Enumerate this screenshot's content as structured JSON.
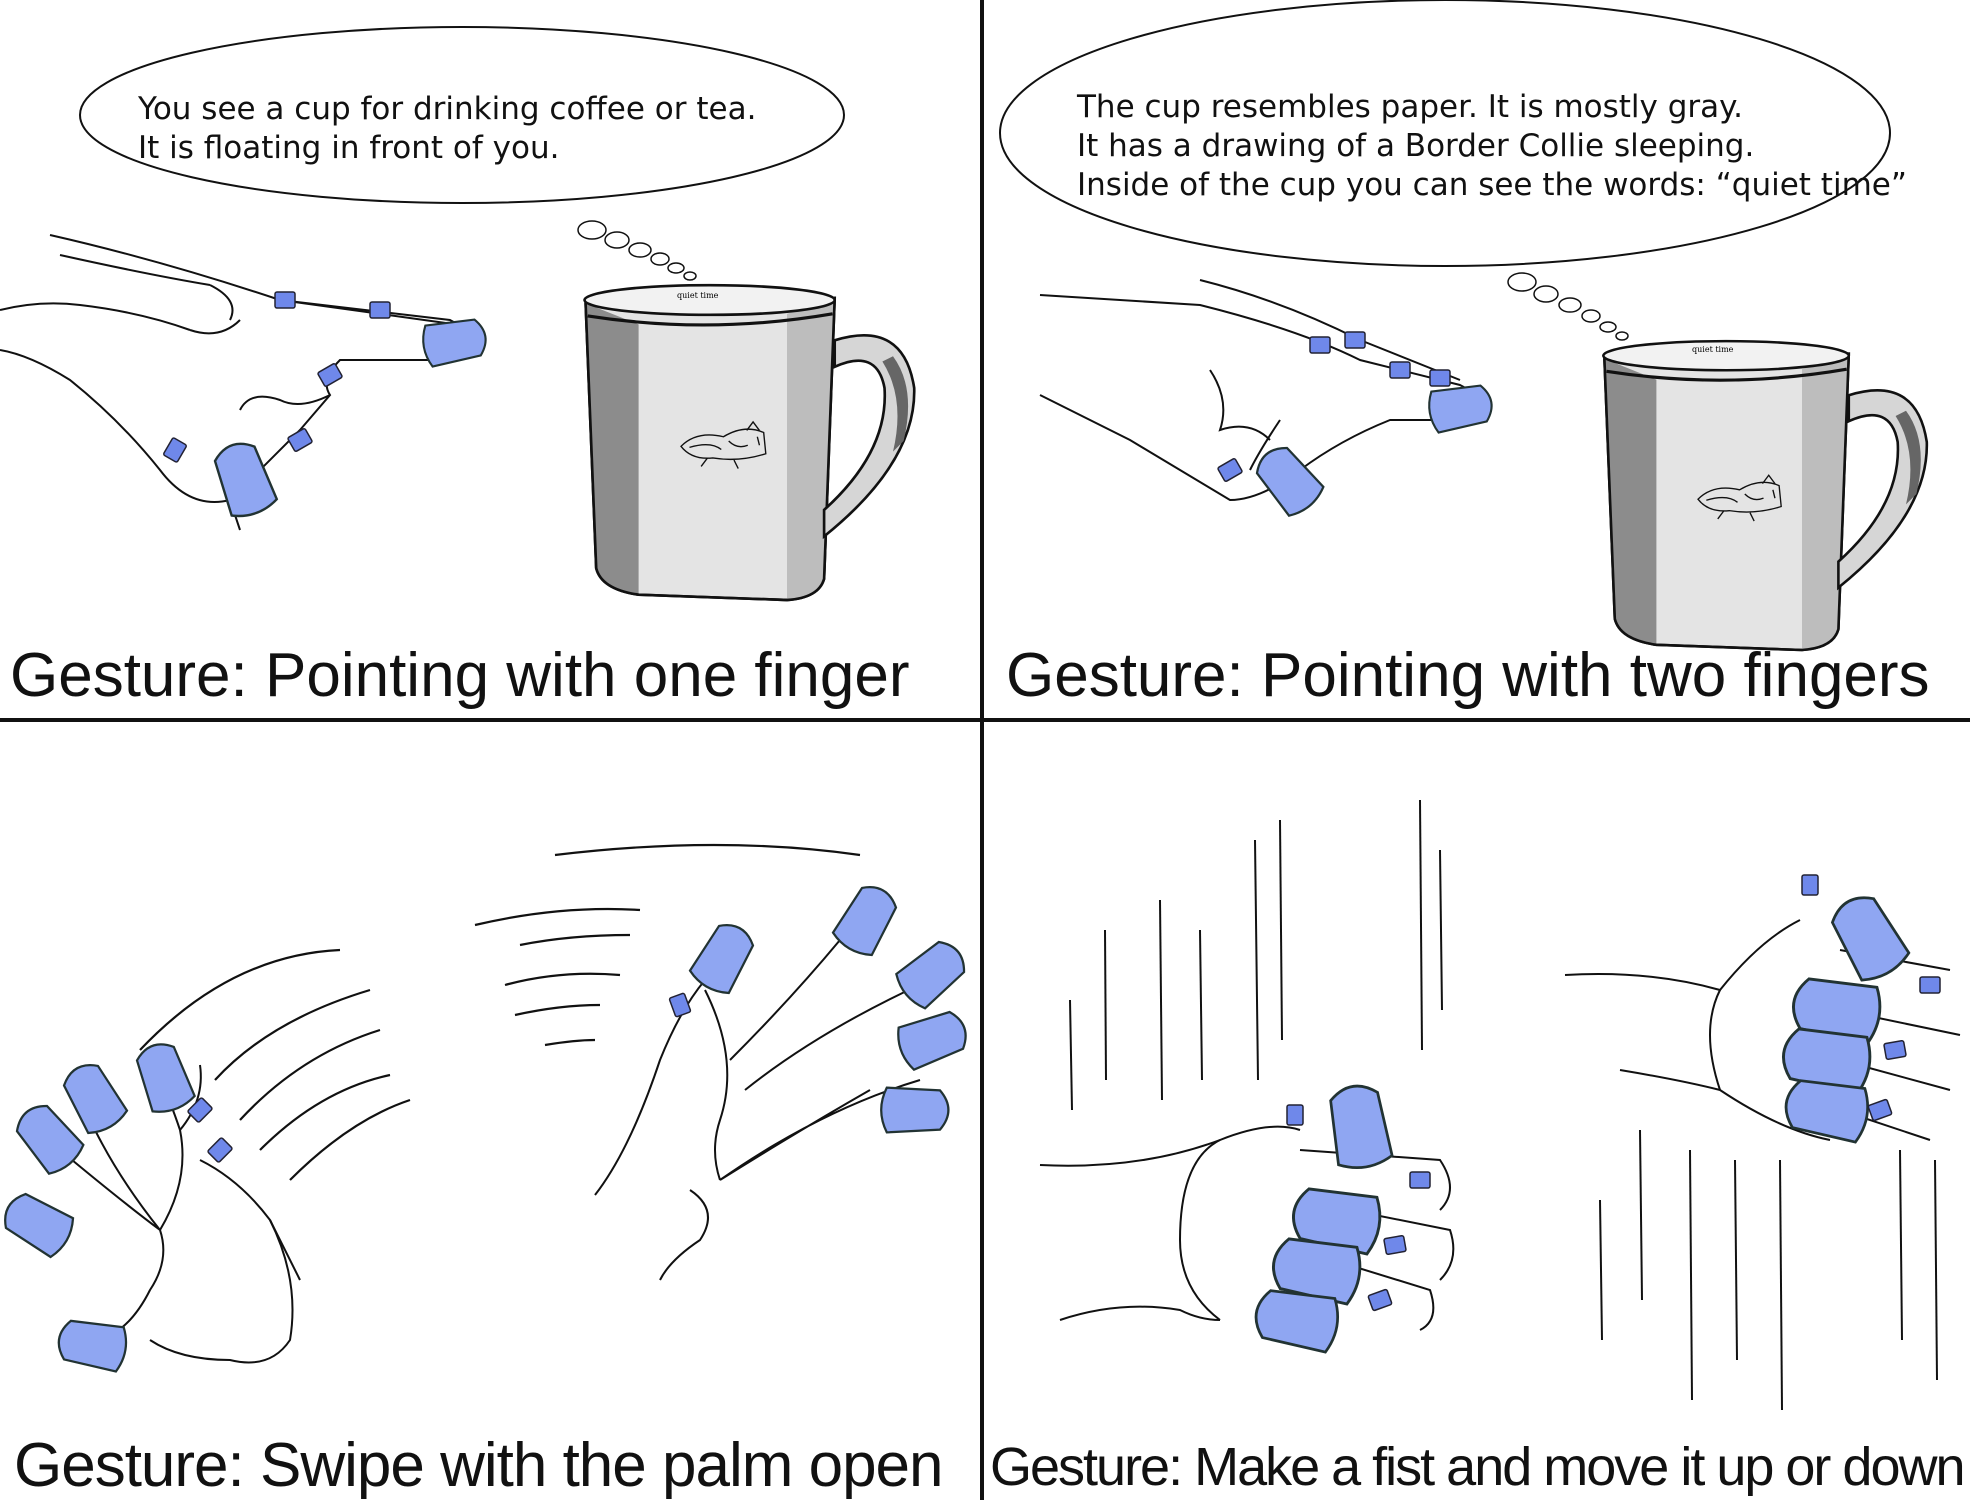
{
  "panels": [
    {
      "caption": "Gesture: Pointing with one finger",
      "bubble_lines": [
        "You see a cup for drinking coffee or tea.",
        "It is floating in front of you."
      ]
    },
    {
      "caption": "Gesture: Pointing with two fingers",
      "bubble_lines": [
        "The cup resembles paper. It is mostly gray.",
        "It has a drawing of a Border Collie sleeping.",
        "Inside of the cup you can see the words: “quiet time”"
      ]
    },
    {
      "caption": "Gesture: Swipe with the palm open"
    },
    {
      "caption": "Gesture: Make a fist and move it up or down"
    }
  ],
  "mug_text": "quiet time",
  "colors": {
    "fingertip_blue": "#8fa6f2",
    "clip_blue": "#6f88ea",
    "outline": "#111111",
    "mug_light": "#e4e4e4",
    "mug_dark": "#8c8c8c"
  }
}
